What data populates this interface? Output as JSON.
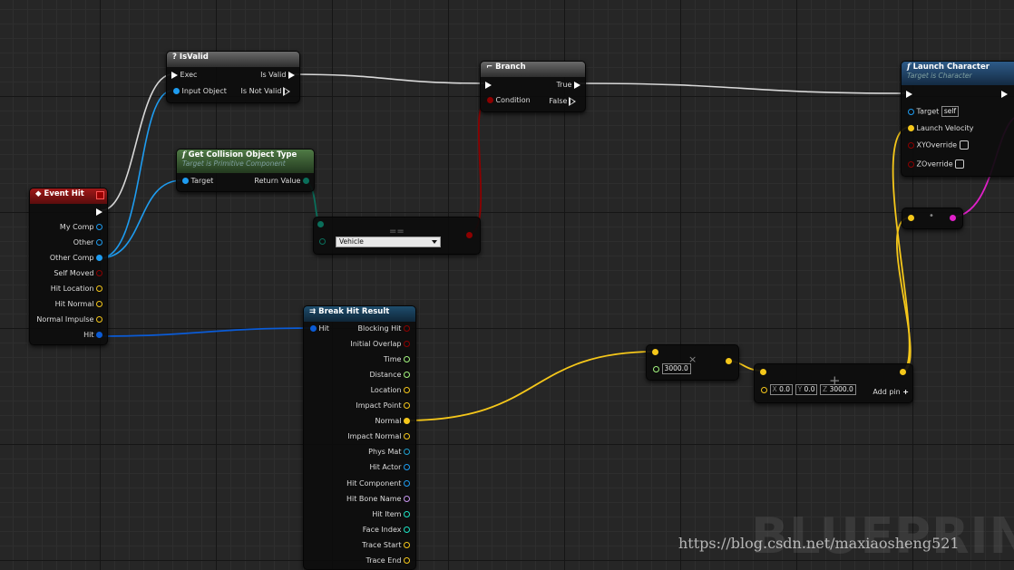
{
  "event_hit": {
    "title": "Event Hit",
    "pins": [
      "My Comp",
      "Other",
      "Other Comp",
      "Self Moved",
      "Hit Location",
      "Hit Normal",
      "Normal Impulse",
      "Hit"
    ]
  },
  "is_valid": {
    "icon": "?",
    "title": "IsValid",
    "exec": "Exec",
    "input": "Input Object",
    "is_valid": "Is Valid",
    "not_valid": "Is Not Valid"
  },
  "branch": {
    "title": "Branch",
    "condition": "Condition",
    "true_label": "True",
    "false_label": "False"
  },
  "collision": {
    "icon": "f",
    "title": "Get Collision Object Type",
    "subtitle": "Target is Primitive Component",
    "target": "Target",
    "ret": "Return Value"
  },
  "equal": {
    "symbol": "==",
    "value": "Vehicle"
  },
  "break_hit": {
    "title": "Break Hit Result",
    "hit": "Hit",
    "pins": [
      "Blocking Hit",
      "Initial Overlap",
      "Time",
      "Distance",
      "Location",
      "Impact Point",
      "Normal",
      "Impact Normal",
      "Phys Mat",
      "Hit Actor",
      "Hit Component",
      "Hit Bone Name",
      "Hit Item",
      "Face Index",
      "Trace Start",
      "Trace End"
    ]
  },
  "multiply": {
    "symbol": "×",
    "value": "3000.0"
  },
  "add": {
    "symbol": "+",
    "x_label": "X",
    "x": "0.0",
    "y_label": "Y",
    "y": "0.0",
    "z_label": "Z",
    "z": "3000.0",
    "add_pin": "Add pin"
  },
  "launch": {
    "icon": "f",
    "title": "Launch Character",
    "subtitle": "Target is Character",
    "target": "Target",
    "self": "self",
    "velocity": "Launch Velocity",
    "xy": "XYOverride",
    "z": "ZOverride"
  },
  "dot_node": {
    "symbol": "•"
  },
  "watermark": "BLUEPRINT",
  "url": "https://blog.csdn.net/maxiaosheng521",
  "colors": {
    "exec": "#ffffff",
    "object": "#1e9cf0",
    "struct": "#0a5bd6",
    "bool": "#8c0000",
    "vector": "#f5c71a",
    "float": "#a3f57e",
    "enum": "#0a6e5a",
    "name": "#c997f2",
    "int": "#1ce3c4",
    "material": "#1fa0d0",
    "rotator": "#9ca8f2"
  }
}
